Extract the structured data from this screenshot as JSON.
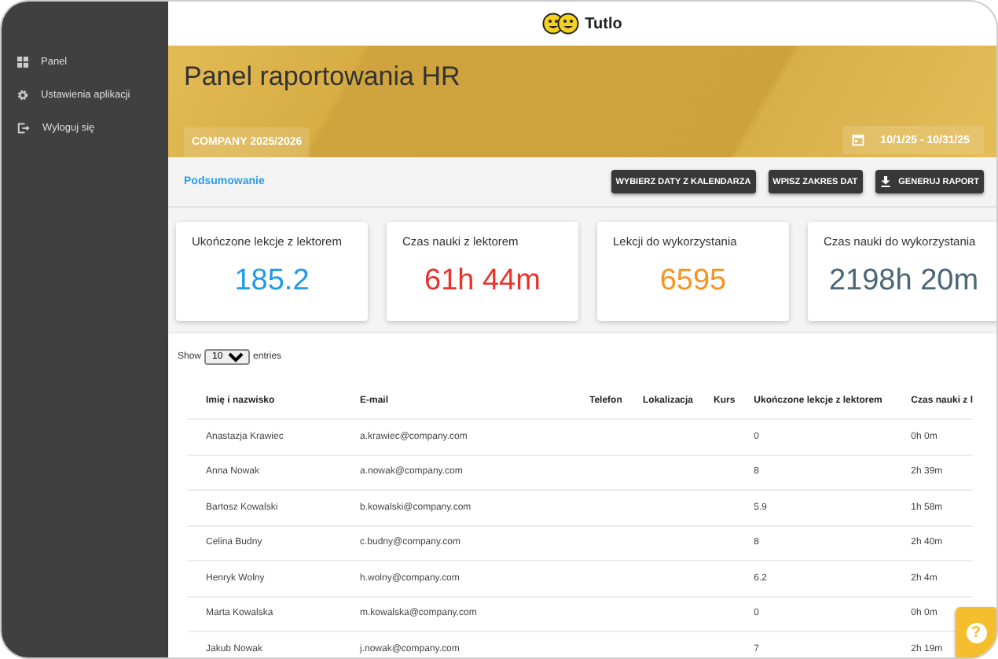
{
  "sidebar": {
    "items": [
      {
        "kind": "grid",
        "label": "Panel"
      },
      {
        "kind": "gear",
        "label": "Ustawienia aplikacji"
      },
      {
        "kind": "logout",
        "label": "Wyloguj się"
      }
    ]
  },
  "header": {
    "logo_text": "Tutlo"
  },
  "banner": {
    "title": "Panel raportowania HR",
    "company": "COMPANY 2025/2026",
    "date_range": "10/1/25 - 10/31/25"
  },
  "toolbar": {
    "link": "Podsumowanie",
    "buttons": [
      {
        "kind": "plain",
        "label": "WYBIERZ DATY Z KALENDARZA"
      },
      {
        "kind": "plain",
        "label": "WPISZ ZAKRES DAT"
      },
      {
        "kind": "download",
        "label": "GENERUJ RAPORT"
      }
    ]
  },
  "stats": [
    {
      "title": "Ukończone lekcje z lektorem",
      "value": "185.2",
      "color": "#1e9be9"
    },
    {
      "title": "Czas nauki z lektorem",
      "value": "61h 44m",
      "color": "#e8322a"
    },
    {
      "title": "Lekcji do wykorzystania",
      "value": "6595",
      "color": "#f7931e"
    },
    {
      "title": "Czas nauki do wykorzystania",
      "value": "2198h 20m",
      "color": "#4b6677"
    }
  ],
  "table": {
    "show_label": "Show",
    "page_size": "10",
    "entries_label": "entries",
    "columns": [
      "Imię i nazwisko",
      "E-mail",
      "Telefon",
      "Lokalizacja",
      "Kurs",
      "Ukończone lekcje z lektorem",
      "Czas nauki z l"
    ],
    "rows": [
      [
        "Anastazja Krawiec",
        "a.krawiec@company.com",
        "",
        "",
        "",
        "0",
        "0h 0m"
      ],
      [
        "Anna Nowak",
        "a.nowak@company.com",
        "",
        "",
        "",
        "8",
        "2h 39m"
      ],
      [
        "Bartosz Kowalski",
        "b.kowalski@company.com",
        "",
        "",
        "",
        "5.9",
        "1h 58m"
      ],
      [
        "Celina Budny",
        "c.budny@company.com",
        "",
        "",
        "",
        "8",
        "2h 40m"
      ],
      [
        "Henryk Wolny",
        "h.wolny@company.com",
        "",
        "",
        "",
        "6.2",
        "2h 4m"
      ],
      [
        "Marta Kowalska",
        "m.kowalska@company.com",
        "",
        "",
        "",
        "0",
        "0h 0m"
      ],
      [
        "Jakub Nowak",
        "j.nowak@company.com",
        "",
        "",
        "",
        "7",
        "2h 19m"
      ]
    ]
  },
  "help_button": {
    "label": "?"
  }
}
